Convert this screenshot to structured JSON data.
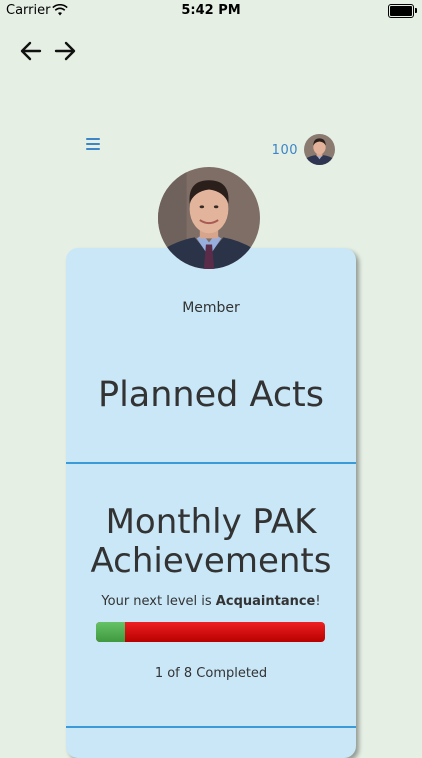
{
  "status_bar": {
    "carrier": "Carrier",
    "time": "5:42 PM"
  },
  "nav": {
    "back_icon": "arrow-left-icon",
    "forward_icon": "arrow-right-icon"
  },
  "header": {
    "menu_icon": "hamburger-menu-icon",
    "points": "100",
    "accent_color": "#3a86c8"
  },
  "profile": {
    "role": "Member"
  },
  "sections": {
    "planned_acts": "Planned Acts",
    "monthly_title_line1": "Monthly PAK",
    "monthly_title_line2": "Achievements",
    "next_level_prefix": "Your next level is ",
    "next_level_name": "Acquaintance",
    "next_level_suffix": "!",
    "completed_text": "1 of 8 Completed",
    "progress_completed": 1,
    "progress_total": 8
  },
  "colors": {
    "background": "#e5efe4",
    "card": "#c9e7f7",
    "progress_done": "#4caf50",
    "progress_remaining": "#d60000",
    "divider": "#3a9bd8"
  }
}
